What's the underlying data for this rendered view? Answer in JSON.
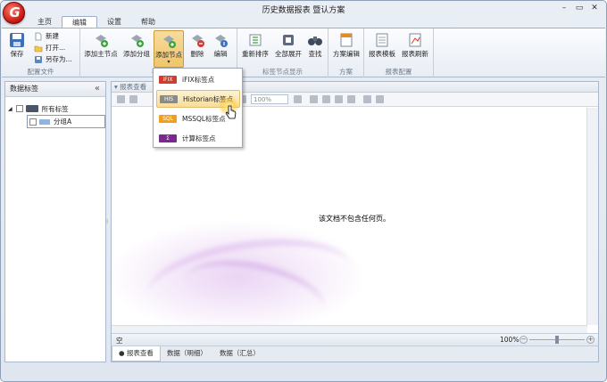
{
  "window": {
    "title": "历史数据报表 暨认方案"
  },
  "tabs": [
    {
      "label": "主页"
    },
    {
      "label": "编辑"
    },
    {
      "label": "设置"
    },
    {
      "label": "帮助"
    }
  ],
  "ribbon": {
    "config": {
      "group_label": "配置文件",
      "save": "保存",
      "new": "新建",
      "open": "打开...",
      "save_as": "另存为..."
    },
    "tags": {
      "group_label": "标签",
      "add_main_node": "添加主节点",
      "add_group": "添加分组",
      "add_node": "添加节点",
      "delete": "删除",
      "edit": "编辑"
    },
    "node_display": {
      "group_label": "标签节点显示",
      "reorder": "重新排序",
      "expand_all": "全部展开",
      "find": "查找"
    },
    "scheme": {
      "group_label": "方案",
      "scheme_edit": "方案编辑"
    },
    "report_config": {
      "group_label": "报表配置",
      "report_template": "报表模板",
      "report_refresh": "报表刷新"
    }
  },
  "add_node_menu": [
    {
      "badge": "iFIX",
      "label": "iFIX标签点",
      "color": "#d23b2e"
    },
    {
      "badge": "HIS",
      "label": "Historian标签点",
      "color": "#8a8a8a"
    },
    {
      "badge": "SQL",
      "label": "MSSQL标签点",
      "color": "#f0a020"
    },
    {
      "badge": "Σ",
      "label": "计算标签点",
      "color": "#7a2a8f"
    }
  ],
  "left_panel": {
    "title": "数据标签",
    "collapse": "«",
    "tree": {
      "root": "所有标签",
      "child": "分组A"
    }
  },
  "report_panel": {
    "header": "报表查看",
    "zoom_box": "100%",
    "empty_message": "该文档不包含任何页。",
    "status_left": "空",
    "zoom_value": "100%",
    "bottom_tabs": [
      {
        "label": "报表查看"
      },
      {
        "label": "数据（明细）"
      },
      {
        "label": "数据（汇总）"
      }
    ]
  }
}
